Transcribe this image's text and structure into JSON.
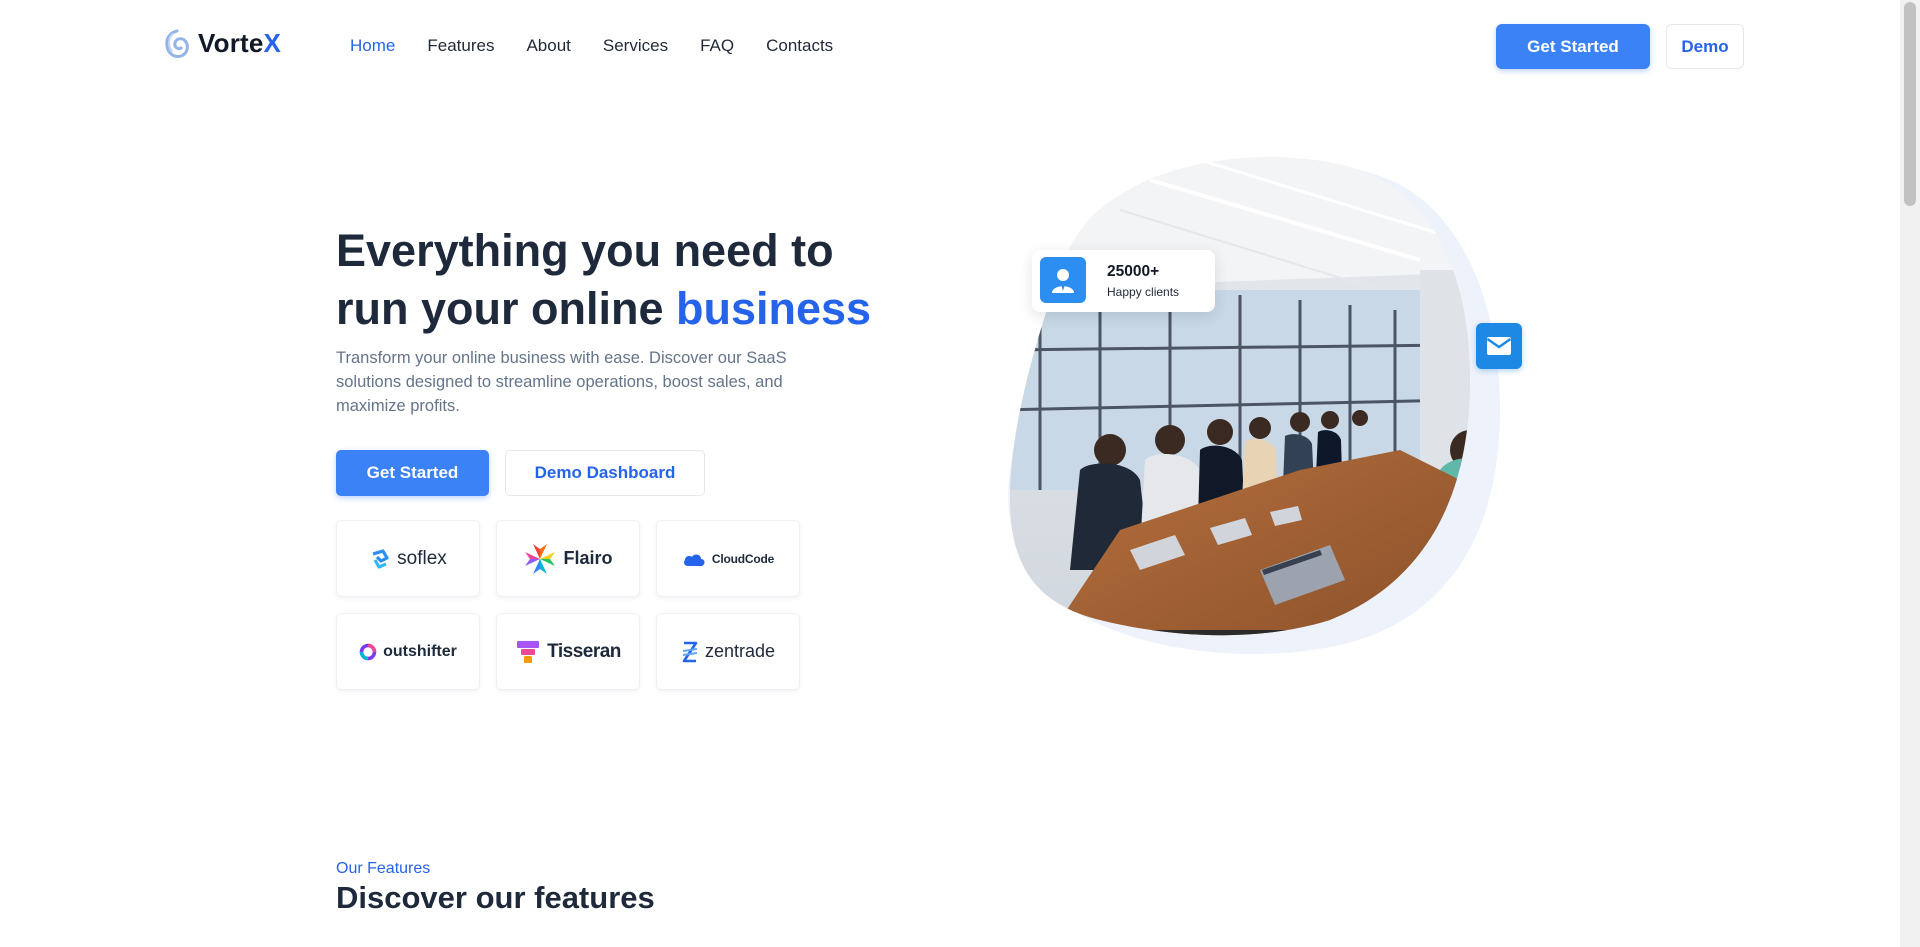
{
  "brand": {
    "name_main": "Vorte",
    "name_accent": "X"
  },
  "nav": {
    "items": [
      {
        "label": "Home",
        "active": true
      },
      {
        "label": "Features",
        "active": false
      },
      {
        "label": "About",
        "active": false
      },
      {
        "label": "Services",
        "active": false
      },
      {
        "label": "FAQ",
        "active": false
      },
      {
        "label": "Contacts",
        "active": false
      }
    ],
    "get_started_label": "Get Started",
    "demo_label": "Demo"
  },
  "hero": {
    "title_line1": "Everything you need to",
    "title_line2_prefix": "run your online ",
    "title_highlight": "business",
    "description": "Transform your online business with ease. Discover our SaaS solutions designed to streamline operations, boost sales, and maximize profits.",
    "primary_label": "Get Started",
    "secondary_label": "Demo Dashboard"
  },
  "partners": [
    {
      "name": "soflex",
      "icon": "soflex-logo-icon"
    },
    {
      "name": "Flairo",
      "icon": "flairo-logo-icon"
    },
    {
      "name": "CloudCode",
      "icon": "cloud-logo-icon"
    },
    {
      "name": "outshifter",
      "icon": "outshifter-logo-icon"
    },
    {
      "name": "Tisseran",
      "icon": "tisseran-logo-icon"
    },
    {
      "name": "zentrade",
      "icon": "zentrade-logo-icon"
    }
  ],
  "stat": {
    "value": "25000+",
    "label": "Happy clients",
    "icon": "user-icon"
  },
  "mail_icon": "mail-icon",
  "features": {
    "eyebrow": "Our Features",
    "title": "Discover our features"
  },
  "colors": {
    "accent": "#2563eb",
    "button": "#3b82f6",
    "heading": "#1e293b",
    "muted": "#64748b"
  }
}
